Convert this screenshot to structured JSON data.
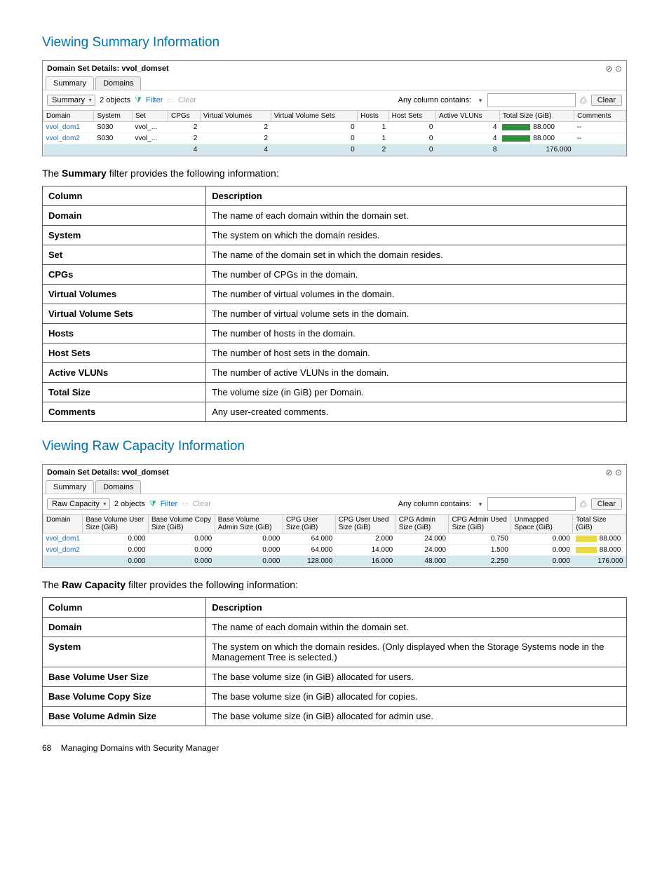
{
  "section1_title": "Viewing Summary Information",
  "panel1": {
    "title": "Domain Set Details: vvol_domset",
    "tabs": [
      "Summary",
      "Domains"
    ],
    "active_tab": 0,
    "toolbar": {
      "view_dropdown": "Summary",
      "objects": "2 objects",
      "filter": "Filter",
      "clear_filter": "Clear",
      "col_contains": "Any column contains:",
      "clear_btn": "Clear"
    },
    "columns": [
      "Domain",
      "System",
      "Set",
      "CPGs",
      "Virtual Volumes",
      "Virtual Volume Sets",
      "Hosts",
      "Host Sets",
      "Active VLUNs",
      "Total Size (GiB)",
      "Comments"
    ],
    "rows": [
      {
        "domain": "vvol_dom1",
        "system": "S030",
        "set": "vvol_...",
        "cpgs": 2,
        "vv": 2,
        "vvs": 0,
        "hosts": 1,
        "hs": 0,
        "av": 4,
        "total": "88.000",
        "comments": "--"
      },
      {
        "domain": "vvol_dom2",
        "system": "S030",
        "set": "vvol_...",
        "cpgs": 2,
        "vv": 2,
        "vvs": 0,
        "hosts": 1,
        "hs": 0,
        "av": 4,
        "total": "88.000",
        "comments": "--"
      }
    ],
    "footer": {
      "cpgs": 4,
      "vv": 4,
      "vvs": 0,
      "hosts": 2,
      "hs": 0,
      "av": 8,
      "total": "176.000"
    }
  },
  "lead1": "The Summary filter provides the following information:",
  "lead1_bold": "Summary",
  "desc1_head": [
    "Column",
    "Description"
  ],
  "desc1": [
    [
      "Domain",
      "The name of each domain within the domain set."
    ],
    [
      "System",
      "The system on which the domain resides."
    ],
    [
      "Set",
      "The name of the domain set in which the domain resides."
    ],
    [
      "CPGs",
      "The number of CPGs in the domain."
    ],
    [
      "Virtual Volumes",
      "The number of virtual volumes in the domain."
    ],
    [
      "Virtual Volume Sets",
      "The number of virtual volume sets in the domain."
    ],
    [
      "Hosts",
      "The number of hosts in the domain."
    ],
    [
      "Host Sets",
      "The number of host sets in the domain."
    ],
    [
      "Active VLUNs",
      "The number of active VLUNs in the domain."
    ],
    [
      "Total Size",
      "The volume size (in GiB) per Domain."
    ],
    [
      "Comments",
      "Any user-created comments."
    ]
  ],
  "section2_title": "Viewing Raw Capacity Information",
  "panel2": {
    "title": "Domain Set Details: vvol_domset",
    "tabs": [
      "Summary",
      "Domains"
    ],
    "active_tab": 0,
    "toolbar": {
      "view_dropdown": "Raw Capacity",
      "objects": "2 objects",
      "filter": "Filter",
      "clear_filter": "Clear",
      "col_contains": "Any column contains:",
      "clear_btn": "Clear"
    },
    "columns": [
      "Domain",
      "Base Volume User Size (GiB)",
      "Base Volume Copy Size (GiB)",
      "Base Volume Admin Size (GiB)",
      "CPG User Size (GiB)",
      "CPG User Used Size (GiB)",
      "CPG Admin Size (GiB)",
      "CPG Admin Used Size (GiB)",
      "Unmapped Space (GiB)",
      "Total Size (GiB)"
    ],
    "rows": [
      {
        "domain": "vvol_dom1",
        "bvu": "0.000",
        "bvc": "0.000",
        "bva": "0.000",
        "cus": "64.000",
        "cuus": "2.000",
        "cas": "24.000",
        "caus": "0.750",
        "unm": "0.000",
        "total": "88.000"
      },
      {
        "domain": "vvol_dom2",
        "bvu": "0.000",
        "bvc": "0.000",
        "bva": "0.000",
        "cus": "64.000",
        "cuus": "14.000",
        "cas": "24.000",
        "caus": "1.500",
        "unm": "0.000",
        "total": "88.000"
      }
    ],
    "footer": {
      "bvu": "0.000",
      "bvc": "0.000",
      "bva": "0.000",
      "cus": "128.000",
      "cuus": "16.000",
      "cas": "48.000",
      "caus": "2.250",
      "unm": "0.000",
      "total": "176.000"
    }
  },
  "lead2": "The Raw Capacity filter provides the following information:",
  "lead2_bold": "Raw Capacity",
  "desc2_head": [
    "Column",
    "Description"
  ],
  "desc2": [
    [
      "Domain",
      "The name of each domain within the domain set."
    ],
    [
      "System",
      "The system on which the domain resides. (Only displayed when the Storage Systems node in the Management Tree is selected.)"
    ],
    [
      "Base Volume User Size",
      "The base volume size (in GiB) allocated for users."
    ],
    [
      "Base Volume Copy Size",
      "The base volume size (in GiB) allocated for copies."
    ],
    [
      "Base Volume Admin Size",
      "The base volume size (in GiB) allocated for admin use."
    ]
  ],
  "footer_text": "68    Managing Domains with Security Manager",
  "page_num": "68",
  "footer_title": "Managing Domains with Security Manager"
}
